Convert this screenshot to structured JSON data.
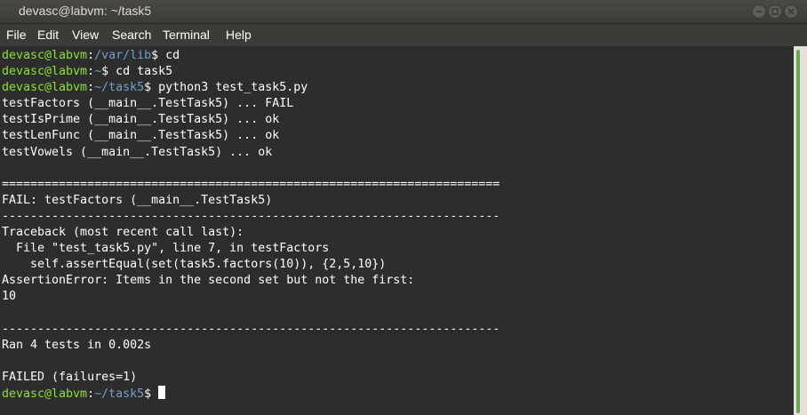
{
  "window": {
    "title": "devasc@labvm: ~/task5"
  },
  "menu": [
    "File",
    "Edit",
    "View",
    "Search",
    "Terminal",
    "Help"
  ],
  "terminal": {
    "colors": {
      "background": "#2d2d2d",
      "text": "#ffffff",
      "prompt_user": "#8ae234",
      "prompt_path": "#729fcf"
    },
    "lines": [
      {
        "user": "devasc@labvm",
        "sep": ":",
        "path": "/var/lib",
        "dollar": "$ ",
        "cmd": "cd"
      },
      {
        "user": "devasc@labvm",
        "sep": ":",
        "path": "~",
        "dollar": "$ ",
        "cmd": "cd task5"
      },
      {
        "user": "devasc@labvm",
        "sep": ":",
        "path": "~/task5",
        "dollar": "$ ",
        "cmd": "python3 test_task5.py"
      },
      {
        "text": "testFactors (__main__.TestTask5) ... FAIL"
      },
      {
        "text": "testIsPrime (__main__.TestTask5) ... ok"
      },
      {
        "text": "testLenFunc (__main__.TestTask5) ... ok"
      },
      {
        "text": "testVowels (__main__.TestTask5) ... ok"
      },
      {
        "text": ""
      },
      {
        "text": "======================================================================"
      },
      {
        "text": "FAIL: testFactors (__main__.TestTask5)"
      },
      {
        "text": "----------------------------------------------------------------------"
      },
      {
        "text": "Traceback (most recent call last):"
      },
      {
        "text": "  File \"test_task5.py\", line 7, in testFactors"
      },
      {
        "text": "    self.assertEqual(set(task5.factors(10)), {2,5,10})"
      },
      {
        "text": "AssertionError: Items in the second set but not the first:"
      },
      {
        "text": "10"
      },
      {
        "text": ""
      },
      {
        "text": "----------------------------------------------------------------------"
      },
      {
        "text": "Ran 4 tests in 0.002s"
      },
      {
        "text": ""
      },
      {
        "text": "FAILED (failures=1)"
      },
      {
        "user": "devasc@labvm",
        "sep": ":",
        "path": "~/task5",
        "dollar": "$ ",
        "cmd": "",
        "cursor": true
      }
    ]
  }
}
